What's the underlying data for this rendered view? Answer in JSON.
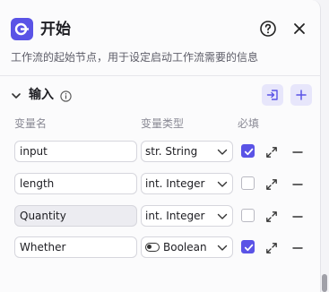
{
  "header": {
    "title": "开始",
    "description": "工作流的起始节点，用于设定启动工作流需要的信息"
  },
  "section": {
    "title": "输入"
  },
  "columns": {
    "name": "变量名",
    "type": "变量类型",
    "required": "必填"
  },
  "rows": [
    {
      "name": "input",
      "type": "str. String",
      "required": true,
      "readonly": false
    },
    {
      "name": "length",
      "type": "int. Integer",
      "required": false,
      "readonly": false
    },
    {
      "name": "Quantity",
      "type": "int. Integer",
      "required": false,
      "readonly": true
    },
    {
      "name": "Whether",
      "type": "Boolean",
      "required": true,
      "readonly": false
    }
  ],
  "colors": {
    "accent": "#5a53e6",
    "accent_light": "#e7e6fb"
  }
}
